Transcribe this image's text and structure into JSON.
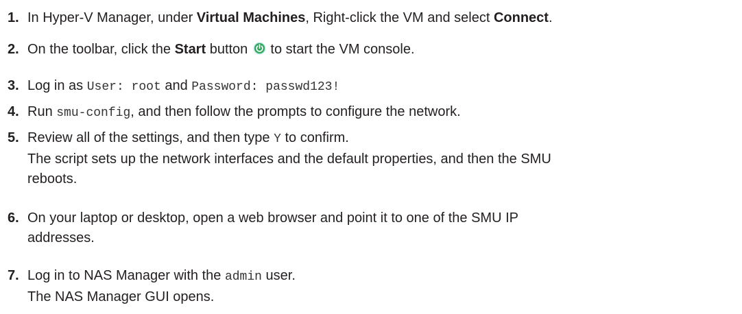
{
  "steps": [
    {
      "number": "1.",
      "t1": "In Hyper-V Manager, under ",
      "b1": "Virtual Machines",
      "t2": ", Right-click the VM and select ",
      "b2": "Connect",
      "t3": "."
    },
    {
      "number": "2.",
      "t1": "On the toolbar, click the ",
      "b1": "Start",
      "t2": " button",
      "icon": "power-icon",
      "t3": " to start the VM console."
    },
    {
      "number": "3.",
      "t1": "Log in as ",
      "c1": "User: root",
      "t2": " and ",
      "c2": "Password: passwd123!"
    },
    {
      "number": "4.",
      "t1": "Run ",
      "c1": "smu-config",
      "t2": ", and then follow the prompts to configure the network."
    },
    {
      "number": "5.",
      "t1": "Review all of the settings, and then type ",
      "c1": "Y",
      "t2": " to confirm.",
      "line2": "The script sets up the network interfaces and the default properties, and then the SMU",
      "line3": "reboots."
    },
    {
      "number": "6.",
      "line1": "On your laptop or desktop, open a web browser and point it to one of the SMU IP",
      "line2": "addresses."
    },
    {
      "number": "7.",
      "t1": "Log in to NAS Manager with the ",
      "c1": "admin",
      "t2": " user.",
      "line2": "The NAS Manager GUI opens."
    }
  ],
  "colors": {
    "text": "#231f20",
    "code": "#333333",
    "icon_fill": "#2eaa5a",
    "icon_ring": "#c8e8f0",
    "icon_symbol": "#ffffff"
  }
}
